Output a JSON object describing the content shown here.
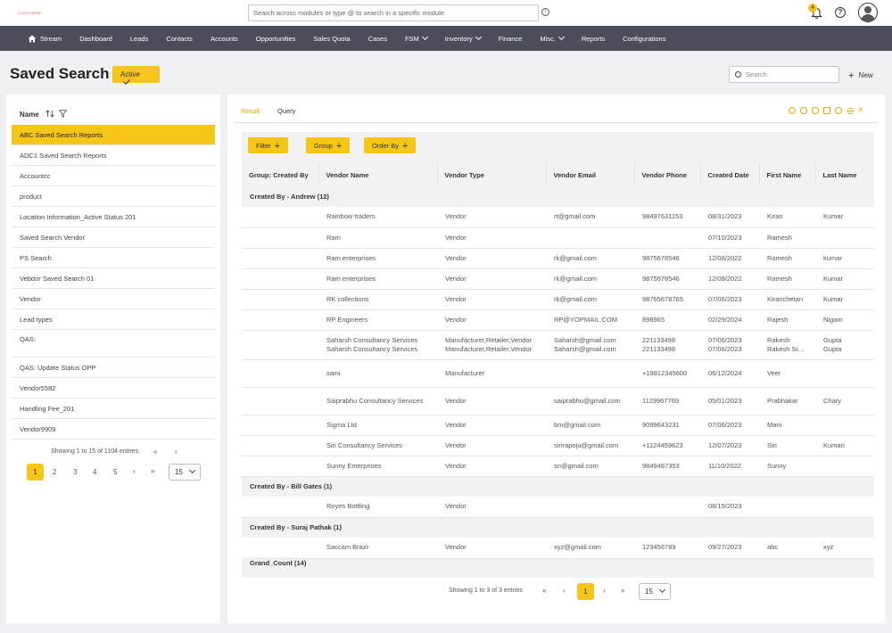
{
  "app": {
    "logo_text": "LOGO HERE",
    "search_placeholder": "Search across modules or type @ to search in a specific module",
    "notification_count": "4"
  },
  "nav": {
    "items": [
      "Stream",
      "Dashboard",
      "Leads",
      "Contacts",
      "Accounts",
      "Opportunities",
      "Sales Quota",
      "Cases",
      "FSM",
      "Inventory",
      "Finance",
      "Misc.",
      "Reports",
      "Configurations"
    ],
    "dropdown_items": [
      "FSM",
      "Inventory",
      "Misc."
    ]
  },
  "page": {
    "title": "Saved Search",
    "status_badge": "Active",
    "search_placeholder": "Search",
    "new_label": "New"
  },
  "left": {
    "column_header": "Name",
    "items": [
      "ABC Saved Search Reports",
      "ADC1 Saved Search Reports",
      "Accountcc",
      "product",
      "Location Information_Active Status 201",
      "Saved Search Vendor",
      "PS Search",
      "Vebdor Saved Search 01",
      "Vendor",
      "Lead types",
      "QAS:",
      "QAS: Update Status OPP",
      "Vendor5582",
      "Handling Fee_201",
      "Vendor9909"
    ],
    "selected_index": 0,
    "footer_text": "Showing 1 to 15 of 1104 entries",
    "pages": [
      "1",
      "2",
      "3",
      "4",
      "5"
    ],
    "current_page": "1",
    "page_size": "15",
    "pager_first": "«",
    "pager_prev": "‹",
    "pager_next": "›",
    "pager_last": "»"
  },
  "right": {
    "tabs": [
      "Result",
      "Query"
    ],
    "active_tab": "Result",
    "chips": [
      "Filter",
      "Group",
      "Order By"
    ],
    "columns": [
      "Group: Created By",
      "Vendor Name",
      "Vendor Type",
      "Vendor Email",
      "Vendor Phone",
      "Created Date",
      "First Name",
      "Last Name"
    ],
    "groups": [
      {
        "label": "Created By - Andrew  (12)",
        "rows": [
          [
            "Rainbow traders",
            "Vendor",
            "rt@gmail.com",
            "98497631153",
            "08/31/2023",
            "Kiran",
            "Kumar"
          ],
          [
            "Ram",
            "Vendor",
            "",
            "",
            "07/10/2023",
            "Ramesh",
            ""
          ],
          [
            "Ram enterprises",
            "Vendor",
            "rk@gmail.com",
            "9875678546",
            "12/08/2022",
            "Ramesh",
            "kumar"
          ],
          [
            "Ram enterprises",
            "Vendor",
            "rk@gmail.com",
            "9875678546",
            "12/08/2022",
            "Ramesh",
            "Kumar"
          ],
          [
            "RK collections",
            "Vendor",
            "rk@gmail.com",
            "98765678765",
            "07/06/2023",
            "Kiranchetan",
            "Kumar"
          ],
          [
            "RP Engineers",
            "Vendor",
            "RP@YOPMAIL.COM",
            "898965",
            "02/29/2024",
            "Rajesh",
            "Nigam"
          ],
          [
            "Saharsh Consultancy Services\nSaharsh Consultancy Services",
            "Manufacturer,Retailer,Vendor\nManufacturer,Retailer,Vendor",
            "Saharsh@gmail.com\nSaharsh@gmail.com",
            "221133498\n221133498",
            "07/06/2023\n07/06/2023",
            "Rakesh\nRakesh Singh",
            "Gupta\nGupta"
          ],
          [
            "saini",
            "Manufacturer",
            "",
            "+19812345600",
            "06/12/2024",
            "Veer",
            ""
          ],
          [
            "Saiprabhu Consultancy Services",
            "Vendor",
            "saiprabhu@gmail.com",
            "1129967769",
            "05/01/2023",
            "Prabhakar",
            "Chary"
          ],
          [
            "Sigma Ltd",
            "Vendor",
            "bm@gmail.com",
            "9099643231",
            "07/06/2023",
            "Mani",
            ""
          ],
          [
            "Siri Consultancy Services",
            "Vendor",
            "sirirapoju@gmail.com",
            "+1124459623",
            "12/07/2023",
            "Siri",
            "Kumari"
          ],
          [
            "Sunny Enterprises",
            "Vendor",
            "sn@gmail.com",
            "9849467353",
            "11/10/2022",
            "Sunny",
            ""
          ]
        ]
      },
      {
        "label": "Created By - Bill Gates  (1)",
        "rows": [
          [
            "Royes Bottling",
            "Vendor",
            "",
            "",
            "08/15/2023",
            "",
            ""
          ]
        ]
      },
      {
        "label": "Created By - Suraj Pathak  (1)",
        "rows": [
          [
            "Saccam Brazi-",
            "Vendor",
            "xyz@gmail.com",
            "123456789",
            "09/27/2023",
            "abc",
            "xyz"
          ]
        ]
      }
    ],
    "grand_total": "Grand_Count  (14)",
    "footer_text": "Showing 1 to 3 of 3 entries",
    "current_page": "1",
    "page_size": "15",
    "pager_first": "«",
    "pager_prev": "‹",
    "pager_next": "›",
    "pager_last": "»"
  },
  "colors": {
    "accent": "#f5c518",
    "nav_bg": "#4b4d58",
    "active_tab": "#e0a800"
  }
}
